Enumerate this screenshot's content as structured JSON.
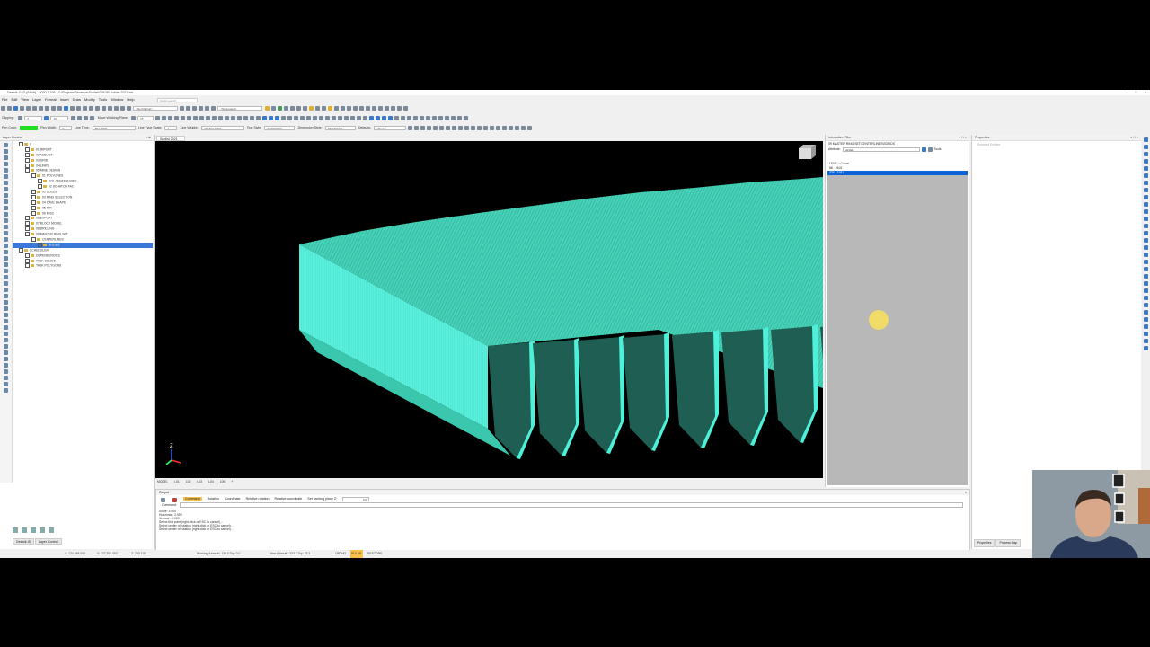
{
  "title_bar": {
    "text": "Deswik.CAD (64 bit) - 2020.3.708 - C:\\Projects\\Revenue\\Sublist\\D SOP Sublist 2021.dsf",
    "controls": [
      "–",
      "□",
      "×"
    ]
  },
  "menu": [
    "File",
    "Edit",
    "View",
    "Layer",
    "Format",
    "Insert",
    "Draw",
    "Modify",
    "Tools",
    "Window",
    "Help"
  ],
  "quick_launch": {
    "placeholder": "Quick Launch"
  },
  "toolbar": {
    "filter_dropdown": "<No Filtering>",
    "legend_dropdown": "<No Legend>",
    "clipping_label": "Clipping:",
    "clip_value_1": "2",
    "clip_value_2": "10",
    "move_working_plane": "Move Working Plane",
    "clip_value_3": "15",
    "pen_color_label": "Pen Color:",
    "pen_color": "#22dd22",
    "pen_width_label": "Pen Width:",
    "pen_width_value": "0",
    "line_type_label": "Line Type:",
    "line_type_value": "BYLAYER",
    "line_type_scale_label": "Line Type Scale:",
    "line_type_scale_value": "1",
    "line_weight_label": "Line Weight:",
    "line_weight_value": "LW_BYLAYER",
    "text_style_label": "Text Style:",
    "text_style_value": "STANDARD",
    "dimension_style_label": "Dimension Style:",
    "dimension_style_value": "STANDARD",
    "defaults_label": "Defaults:",
    "defaults_value": "<None>"
  },
  "layer_control": {
    "title": "Layer Control",
    "items": [
      {
        "label": "0",
        "indent": 1
      },
      {
        "label": "01 IMPORT",
        "indent": 2
      },
      {
        "label": "02 ASBUILT",
        "indent": 2
      },
      {
        "label": "03 GRID",
        "indent": 2
      },
      {
        "label": "04 LINKS",
        "indent": 2
      },
      {
        "label": "05 MINE DESIGN",
        "indent": 2
      },
      {
        "label": "01 POLYLINES",
        "indent": 3
      },
      {
        "label": "POL CENTERLINES",
        "indent": 4
      },
      {
        "label": "02 SCHATCH FAC",
        "indent": 4
      },
      {
        "label": "02 SOLIDS",
        "indent": 3
      },
      {
        "label": "03 RING SELECTION",
        "indent": 3
      },
      {
        "label": "04 CAVE SHAPE",
        "indent": 3
      },
      {
        "label": "05 R R",
        "indent": 3
      },
      {
        "label": "06 MISC",
        "indent": 3
      },
      {
        "label": "06 EXPORT",
        "indent": 2
      },
      {
        "label": "07 BLOCK MODEL",
        "indent": 2
      },
      {
        "label": "08 DRILLING",
        "indent": 2
      },
      {
        "label": "09 MASTER RING SET",
        "indent": 2
      },
      {
        "label": "CENTERLINES",
        "indent": 3
      },
      {
        "label": "SOLIDS",
        "indent": 4,
        "selected": true
      },
      {
        "label": "SCHEDULER",
        "indent": 1
      },
      {
        "label": "DEPENDENCIES",
        "indent": 2
      },
      {
        "label": "TASK SOLIDS",
        "indent": 2
      },
      {
        "label": "TASK POLYGONS",
        "indent": 2
      }
    ],
    "tabs": [
      "Deswik.IS",
      "Layer Control"
    ]
  },
  "document_tab": "Sublist 2021",
  "viewport": {
    "axis_label": "Z",
    "solid_color": "#3fdcc0",
    "background": "#000000"
  },
  "view_tabs": [
    "MODEL",
    "L01",
    "L02",
    "L03",
    "L04",
    "L05",
    "+"
  ],
  "output": {
    "title": "Output",
    "toolbar": [
      "Command",
      "Rotation",
      "Coordinate",
      "Relative rotation",
      "Relative coordinate",
      "Set working plane Z:"
    ],
    "working_plane_z": "0.0",
    "command_label": "Command:",
    "lines": [
      "Slope:      3.000",
      "Horizontal:     2.999",
      "Vertical:    -0.000",
      "Select first point (right-click or ESC to cancel)...",
      "Select center of rotation (right-click or ESC to cancel)...",
      "Select center of rotation (right-click or ESC to cancel)..."
    ]
  },
  "status_bar": {
    "x": "X: 124,468.009",
    "y": "Y: 237,397.453",
    "z": "Z: 740.115",
    "working_azimuth": "Working Azimuth: 139.0 Dip: 0.0",
    "view_azimuth": "View Azimuth: 333.7 Dip: 75.3",
    "ortho": "ORTHO",
    "polar": "POLAR",
    "restore": "RESTORE"
  },
  "interactive_filter": {
    "title": "Interactive Filter",
    "layer_path": "09 MASTER RING SET\\CENTERLINES\\SOLIDS",
    "attribute_label": "Attribute:",
    "attribute_value": "LEVEL",
    "tools_label": "Tools",
    "column_header": "LEVE ~ Count",
    "rows": [
      {
        "level": "Nil",
        "count": "2402",
        "selected": false
      },
      {
        "level": "335",
        "count": "2281",
        "selected": true
      }
    ]
  },
  "properties": {
    "title": "Properties",
    "placeholder": "Selected Entities",
    "tabs": [
      "Properties",
      "Process Map"
    ]
  }
}
